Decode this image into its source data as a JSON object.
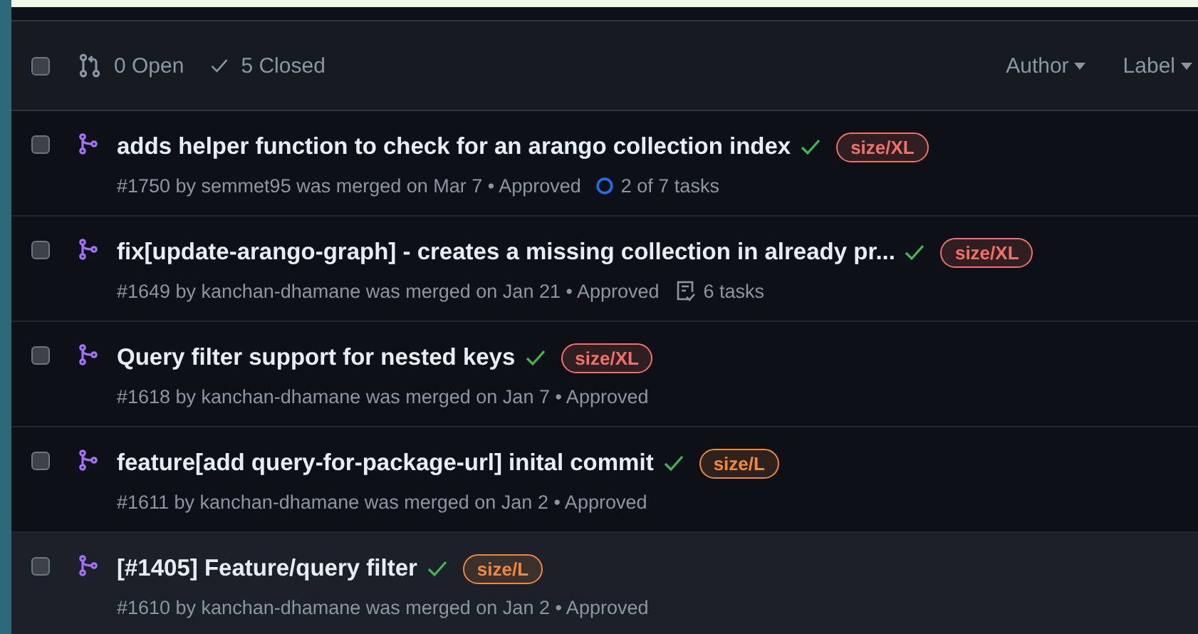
{
  "header": {
    "checked": false,
    "open": "0 Open",
    "closed": "5 Closed",
    "filters": [
      "Author",
      "Label"
    ]
  },
  "rows": [
    {
      "title": "adds helper function to check for an arango collection index",
      "label": {
        "text": "size/XL",
        "color": "#f47067"
      },
      "meta": "#1750 by semmet95 was merged on Mar 7 • Approved",
      "tasks": {
        "kind": "progress",
        "text": "2 of 7 tasks"
      },
      "highlighted": false
    },
    {
      "title": "fix[update-arango-graph] - creates a missing collection in already pr...",
      "label": {
        "text": "size/XL",
        "color": "#f47067"
      },
      "meta": "#1649 by kanchan-dhamane was merged on Jan 21 • Approved",
      "tasks": {
        "kind": "list",
        "text": "6 tasks"
      },
      "highlighted": false
    },
    {
      "title": "Query filter support for nested keys",
      "label": {
        "text": "size/XL",
        "color": "#f47067"
      },
      "meta": "#1618 by kanchan-dhamane was merged on Jan 7 • Approved",
      "highlighted": false
    },
    {
      "title": "feature[add query-for-package-url] inital commit",
      "label": {
        "text": "size/L",
        "color": "#f0883e"
      },
      "meta": "#1611 by kanchan-dhamane was merged on Jan 2 • Approved",
      "highlighted": false
    },
    {
      "title": "[#1405] Feature/query filter",
      "label": {
        "text": "size/L",
        "color": "#f0883e"
      },
      "meta": "#1610 by kanchan-dhamane was merged on Jan 2 • Approved",
      "highlighted": true
    }
  ]
}
